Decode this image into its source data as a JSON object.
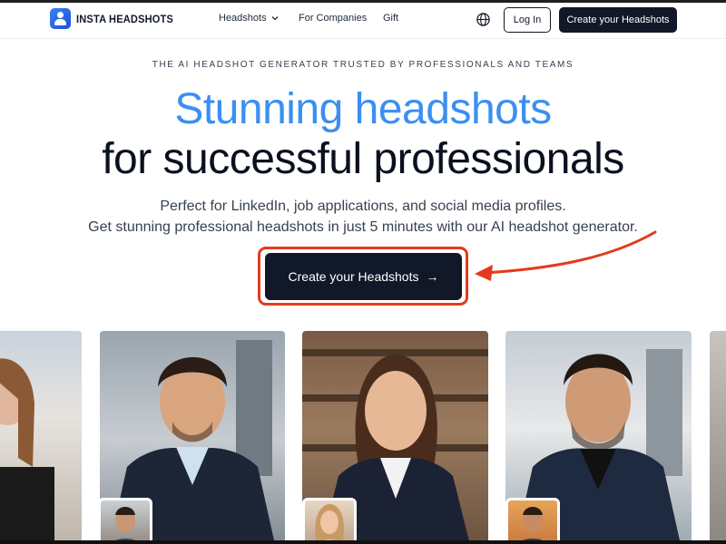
{
  "nav": {
    "brand": "INSTA HEADSHOTS",
    "links": [
      {
        "label": "Headshots"
      },
      {
        "label": "For Companies"
      },
      {
        "label": "Gift"
      }
    ],
    "login_label": "Log In",
    "create_label": "Create your Headshots"
  },
  "hero": {
    "eyebrow": "THE AI HEADSHOT GENERATOR TRUSTED BY PROFESSIONALS AND TEAMS",
    "title_line1": "Stunning headshots",
    "title_line2": "for successful professionals",
    "subtitle_line1": "Perfect for LinkedIn, job applications, and social media profiles.",
    "subtitle_line2": "Get stunning professional headshots in just 5 minutes with our AI headshot generator.",
    "cta_label": "Create your Headshots",
    "cta_arrow": "→"
  },
  "colors": {
    "accent_blue": "#3b8ff2",
    "dark": "#111827",
    "highlight_red": "#e5391f"
  },
  "icons": [
    "logo-icon",
    "chevron-down-icon",
    "globe-icon",
    "arrow-right-icon",
    "annotation-arrow"
  ]
}
